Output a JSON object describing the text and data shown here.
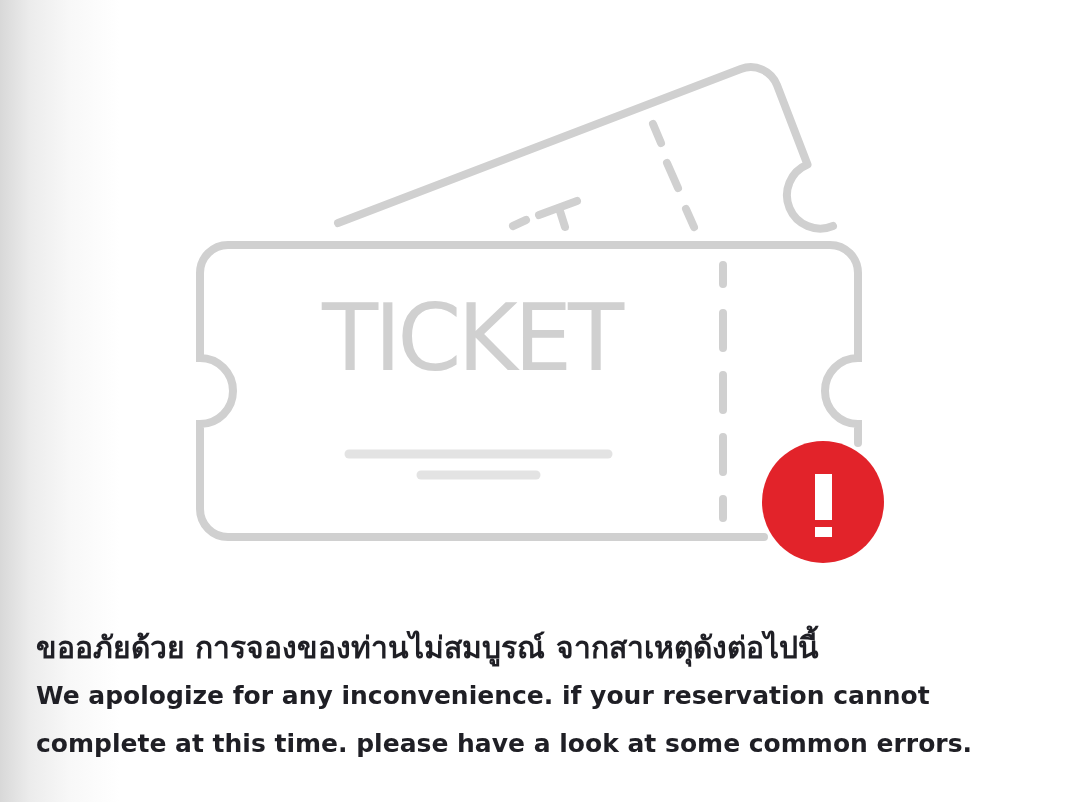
{
  "illustration": {
    "ticket_text": "TICKET"
  },
  "message": {
    "thai": "ขออภัยด้วย การจองของท่านไม่สมบูรณ์ จากสาเหตุดังต่อไปนี้",
    "english": "We apologize for any inconvenience. if your reservation cannot complete at this time. please have a look at some common errors."
  }
}
